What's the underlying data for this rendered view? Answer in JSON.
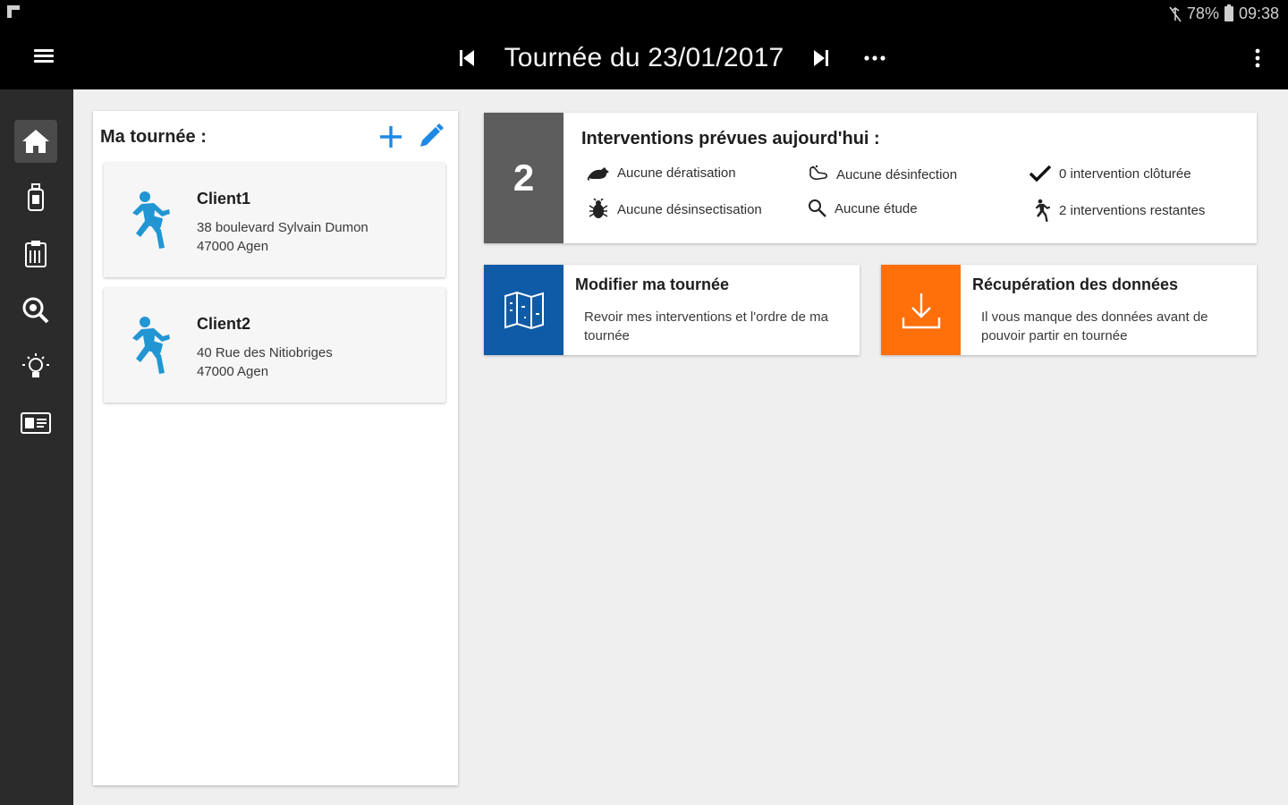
{
  "status_bar": {
    "battery": "78%",
    "time": "09:38"
  },
  "app_bar": {
    "title": "Tournée du 23/01/2017"
  },
  "rail": {
    "items": [
      {
        "icon": "home-icon",
        "active": true
      },
      {
        "icon": "bottle-icon"
      },
      {
        "icon": "clipboard-icon"
      },
      {
        "icon": "zoom-icon"
      },
      {
        "icon": "lightbulb-icon"
      },
      {
        "icon": "id-card-icon"
      }
    ]
  },
  "tour": {
    "title": "Ma tournée :",
    "clients": [
      {
        "name": "Client1",
        "address_line1": "38 boulevard Sylvain Dumon",
        "address_line2": "47000 Agen"
      },
      {
        "name": "Client2",
        "address_line1": "40 Rue des Nitiobriges",
        "address_line2": "47000 Agen"
      }
    ]
  },
  "summary": {
    "count": "2",
    "title": "Interventions prévues aujourd'hui :",
    "stats": {
      "deratisation": "Aucune dératisation",
      "desinfection": "Aucune désinfection",
      "cloturee": "0 intervention clôturée",
      "desinsectisation": "Aucune désinsectisation",
      "etude": "Aucune étude",
      "restantes": "2 interventions restantes"
    }
  },
  "actions": {
    "modifier": {
      "title": "Modifier ma tournée",
      "desc": "Revoir mes interventions et l'ordre de ma tournée",
      "color": "#0f5ba7"
    },
    "recuperation": {
      "title": "Récupération des données",
      "desc": "Il vous manque des données avant de pouvoir partir en tournée",
      "color": "#ff6f0a"
    }
  },
  "colors": {
    "accent_blue": "#1e88e5",
    "runner_blue": "#2196d3"
  }
}
